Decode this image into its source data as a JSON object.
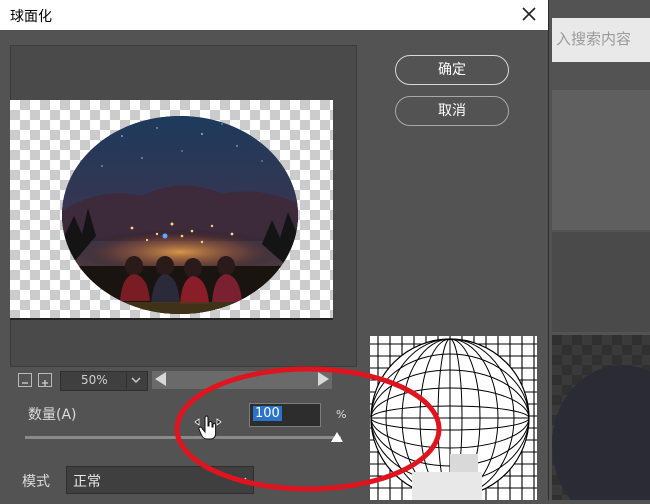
{
  "dialog": {
    "title": "球面化",
    "ok_label": "确定",
    "cancel_label": "取消"
  },
  "preview": {
    "zoom_value": "50%"
  },
  "amount": {
    "label": "数量(A)",
    "value": "100",
    "unit": "%",
    "slider_fraction": 1.0
  },
  "mode": {
    "label": "模式",
    "value": "正常"
  },
  "background_app": {
    "search_placeholder": "入搜索内容"
  },
  "colors": {
    "dialog_bg": "#535353",
    "annotation": "#e0141e",
    "selection": "#2a73c8"
  },
  "icons": [
    "close-icon",
    "zoom-minus-icon",
    "zoom-plus-icon",
    "chevron-down-icon",
    "arrow-left-icon",
    "arrow-right-icon",
    "hand-cursor-icon",
    "slider-thumb-icon"
  ]
}
